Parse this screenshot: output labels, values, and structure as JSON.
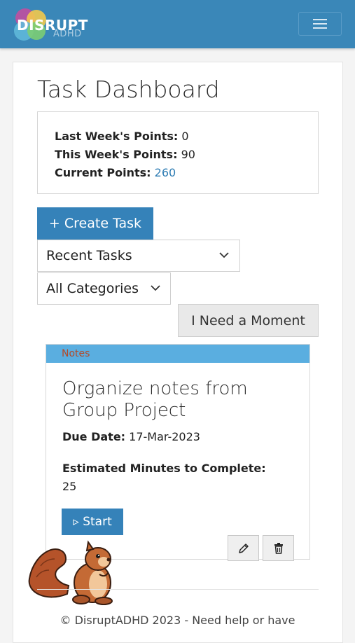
{
  "brand": {
    "name": "DISRUPT",
    "sub": "ADHD",
    "colors": {
      "navbar": "#3a87b8",
      "primary": "#3582b9",
      "task_header": "#5aaee0"
    }
  },
  "nav": {
    "menu_icon": "hamburger-icon"
  },
  "page": {
    "title": "Task Dashboard"
  },
  "points": {
    "last_week_label": "Last Week's Points:",
    "last_week_value": "0",
    "this_week_label": "This Week's Points:",
    "this_week_value": "90",
    "current_label": "Current Points:",
    "current_value": "260"
  },
  "actions": {
    "create_task": "+ Create Task",
    "need_moment": "I Need a Moment"
  },
  "filters": {
    "sort_selected": "Recent Tasks",
    "category_selected": "All Categories"
  },
  "tasks": [
    {
      "category": "Notes",
      "title": "Organize notes from Group Project",
      "due_label": "Due Date:",
      "due_value": "17-Mar-2023",
      "est_label": "Estimated Minutes to Complete:",
      "est_value": "25",
      "start_label": "▹ Start",
      "edit_icon": "pencil-icon",
      "delete_icon": "trash-icon"
    }
  ],
  "footer": {
    "text": "© DisruptADHD 2023 - Need help or have"
  }
}
